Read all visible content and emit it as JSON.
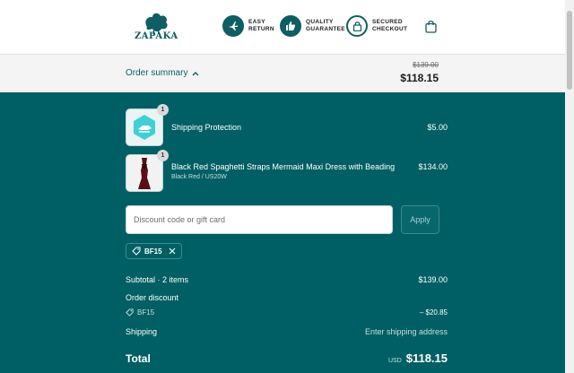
{
  "header": {
    "logo_text": "ZAPAKA",
    "badges": [
      {
        "icon": "airplane-icon",
        "line1": "EASY",
        "line2": "RETURN"
      },
      {
        "icon": "thumbs-up-icon",
        "line1": "QUALITY",
        "line2": "GUARANTEE"
      },
      {
        "icon": "lock-icon",
        "line1": "SECURED",
        "line2": "CHECKOUT"
      }
    ],
    "cart_icon": "shopping-bag-icon"
  },
  "summary_bar": {
    "toggle_label": "Order summary",
    "original_price": "$139.00",
    "current_price": "$118.15"
  },
  "items": [
    {
      "name": "Shipping Protection",
      "variant": "",
      "quantity": "1",
      "price": "$5.00",
      "icon": "shield-icon"
    },
    {
      "name": "Black Red Spaghetti Straps Mermaid Maxi Dress with Beading",
      "variant": "Black Red / US20W",
      "quantity": "1",
      "price": "$134.00",
      "icon": "dress-image"
    }
  ],
  "discount": {
    "placeholder": "Discount code or gift card",
    "value": "",
    "apply_label": "Apply",
    "applied_code": "BF15"
  },
  "totals": {
    "subtotal_label": "Subtotal · 2 items",
    "subtotal_value": "$139.00",
    "order_discount_label": "Order discount",
    "discount_code": "BF15",
    "discount_value": "– $20.85",
    "shipping_label": "Shipping",
    "shipping_value": "Enter shipping address",
    "total_label": "Total",
    "currency": "USD",
    "total_value": "$118.15"
  },
  "colors": {
    "brand": "#005f64",
    "header_bg": "#ffffff",
    "summary_bg": "#f4f4f4"
  }
}
